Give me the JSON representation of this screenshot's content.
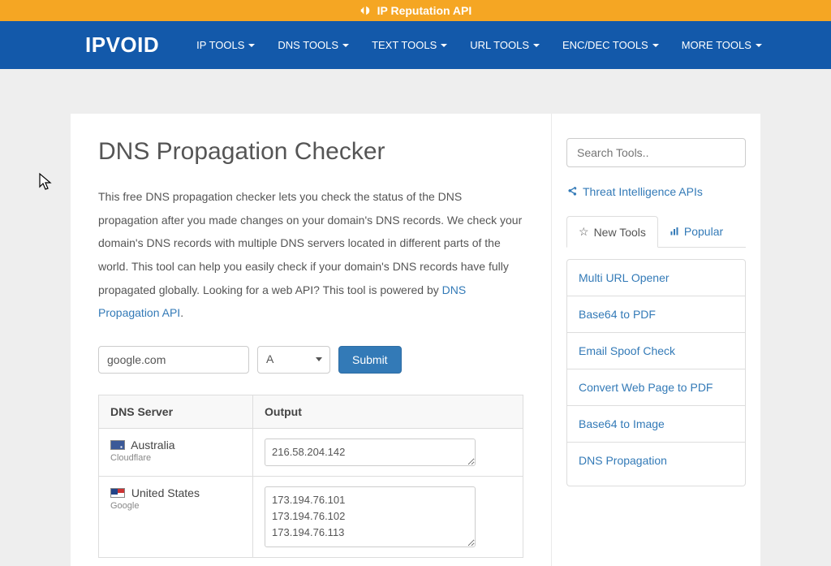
{
  "banner": {
    "label": "IP Reputation API"
  },
  "brand": "IPVOID",
  "nav": [
    {
      "label": "IP TOOLS"
    },
    {
      "label": "DNS TOOLS"
    },
    {
      "label": "TEXT TOOLS"
    },
    {
      "label": "URL TOOLS"
    },
    {
      "label": "ENC/DEC TOOLS"
    },
    {
      "label": "MORE TOOLS"
    }
  ],
  "page": {
    "title": "DNS Propagation Checker",
    "intro_pre": "This free DNS propagation checker lets you check the status of the DNS propagation after you made changes on your domain's DNS records. We check your domain's DNS records with multiple DNS servers located in different parts of the world. This tool can help you easily check if your domain's DNS records have fully propagated globally. Looking for a web API? This tool is powered by ",
    "intro_link": "DNS Propagation API",
    "intro_post": "."
  },
  "form": {
    "domain_value": "google.com",
    "record_type": "A",
    "submit_label": "Submit"
  },
  "table": {
    "headers": {
      "server": "DNS Server",
      "output": "Output"
    },
    "rows": [
      {
        "country": "Australia",
        "provider": "Cloudflare",
        "flag": "au",
        "output": "216.58.204.142"
      },
      {
        "country": "United States",
        "provider": "Google",
        "flag": "us",
        "output": "173.194.76.101\n173.194.76.102\n173.194.76.113"
      }
    ]
  },
  "sidebar": {
    "search_placeholder": "Search Tools..",
    "threat_label": "Threat Intelligence APIs",
    "tabs": {
      "new": "New Tools",
      "popular": "Popular"
    },
    "tools": [
      "Multi URL Opener",
      "Base64 to PDF",
      "Email Spoof Check",
      "Convert Web Page to PDF",
      "Base64 to Image",
      "DNS Propagation"
    ]
  }
}
